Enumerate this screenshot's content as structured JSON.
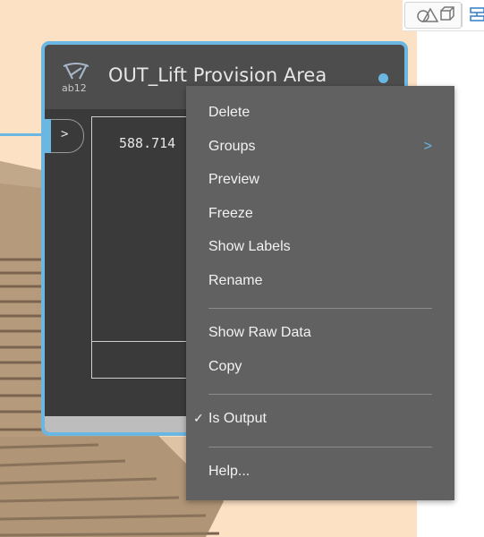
{
  "node": {
    "title": "OUT_Lift Provision Area",
    "icon": "string-icon",
    "icon_text": "ab12",
    "input_port_label": ">",
    "output_value": "588.714"
  },
  "context_menu": {
    "items": [
      {
        "label": "Delete"
      },
      {
        "label": "Groups",
        "has_submenu": true,
        "submenu_icon": "chevron-right-icon"
      },
      {
        "label": "Preview"
      },
      {
        "label": "Freeze"
      },
      {
        "label": "Show Labels"
      },
      {
        "label": "Rename"
      },
      {
        "label": "Show Raw Data"
      },
      {
        "label": "Copy"
      },
      {
        "label": "Is Output",
        "checked": true
      },
      {
        "label": "Help..."
      }
    ],
    "submenu_arrow": ">",
    "check_mark": "✓"
  },
  "toolbar": {
    "icons": [
      "geometry-view-icon",
      "graph-view-icon"
    ]
  },
  "colors": {
    "accent": "#6ab7e3",
    "canvas_bg": "#fde1c4",
    "node_body": "#3a3a3a",
    "node_header": "#4d4d4d",
    "menu_bg": "#616161"
  }
}
